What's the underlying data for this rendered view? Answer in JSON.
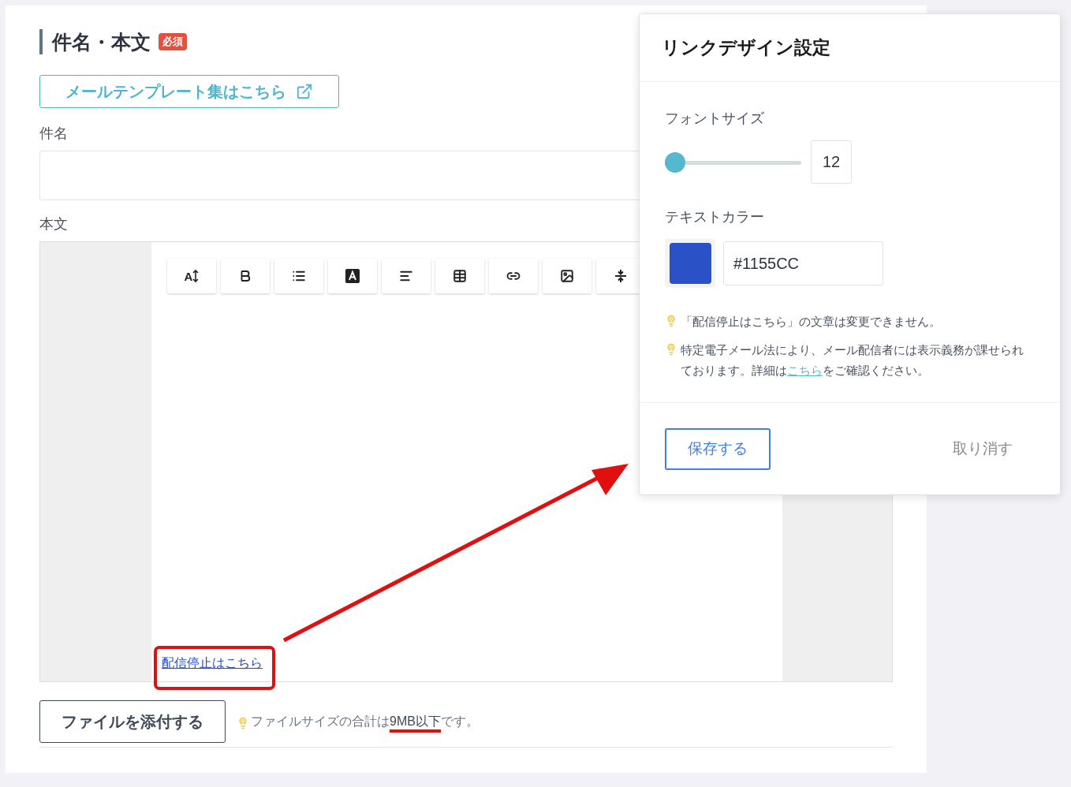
{
  "section": {
    "title": "件名・本文",
    "badge": "必須"
  },
  "template_link": {
    "label": "メールテンプレート集はこちら"
  },
  "subject": {
    "label": "件名"
  },
  "body": {
    "label": "本文",
    "toolbar": [
      {
        "kind": "font-size",
        "label": "A"
      },
      {
        "kind": "bold"
      },
      {
        "kind": "list"
      },
      {
        "kind": "text-color"
      },
      {
        "kind": "align"
      },
      {
        "kind": "table"
      },
      {
        "kind": "link"
      },
      {
        "kind": "image"
      },
      {
        "kind": "divider"
      }
    ],
    "unsubscribe_link": "配信停止はこちら"
  },
  "attach_button": "ファイルを添付する",
  "file_note": "ファイルサイズの合計は**9MB以下**です。",
  "popover": {
    "title": "リンクデザイン設定",
    "font_size": {
      "label": "フォントサイズ",
      "level": 0,
      "value": "12"
    },
    "text_color": {
      "label": "テキストカラー",
      "color": "#2a52c6",
      "value": "#1155CC"
    },
    "notes": [
      {
        "before": "「配信停止はこちら」の文章は変更できません。"
      },
      {
        "before": "特定電子メール法により、メール配信者には表示義務が課せられております。詳細は",
        "link": "こちら",
        "after": "をご確認ください。"
      }
    ],
    "save_button": "保存する",
    "cancel_button": "取り消す"
  }
}
